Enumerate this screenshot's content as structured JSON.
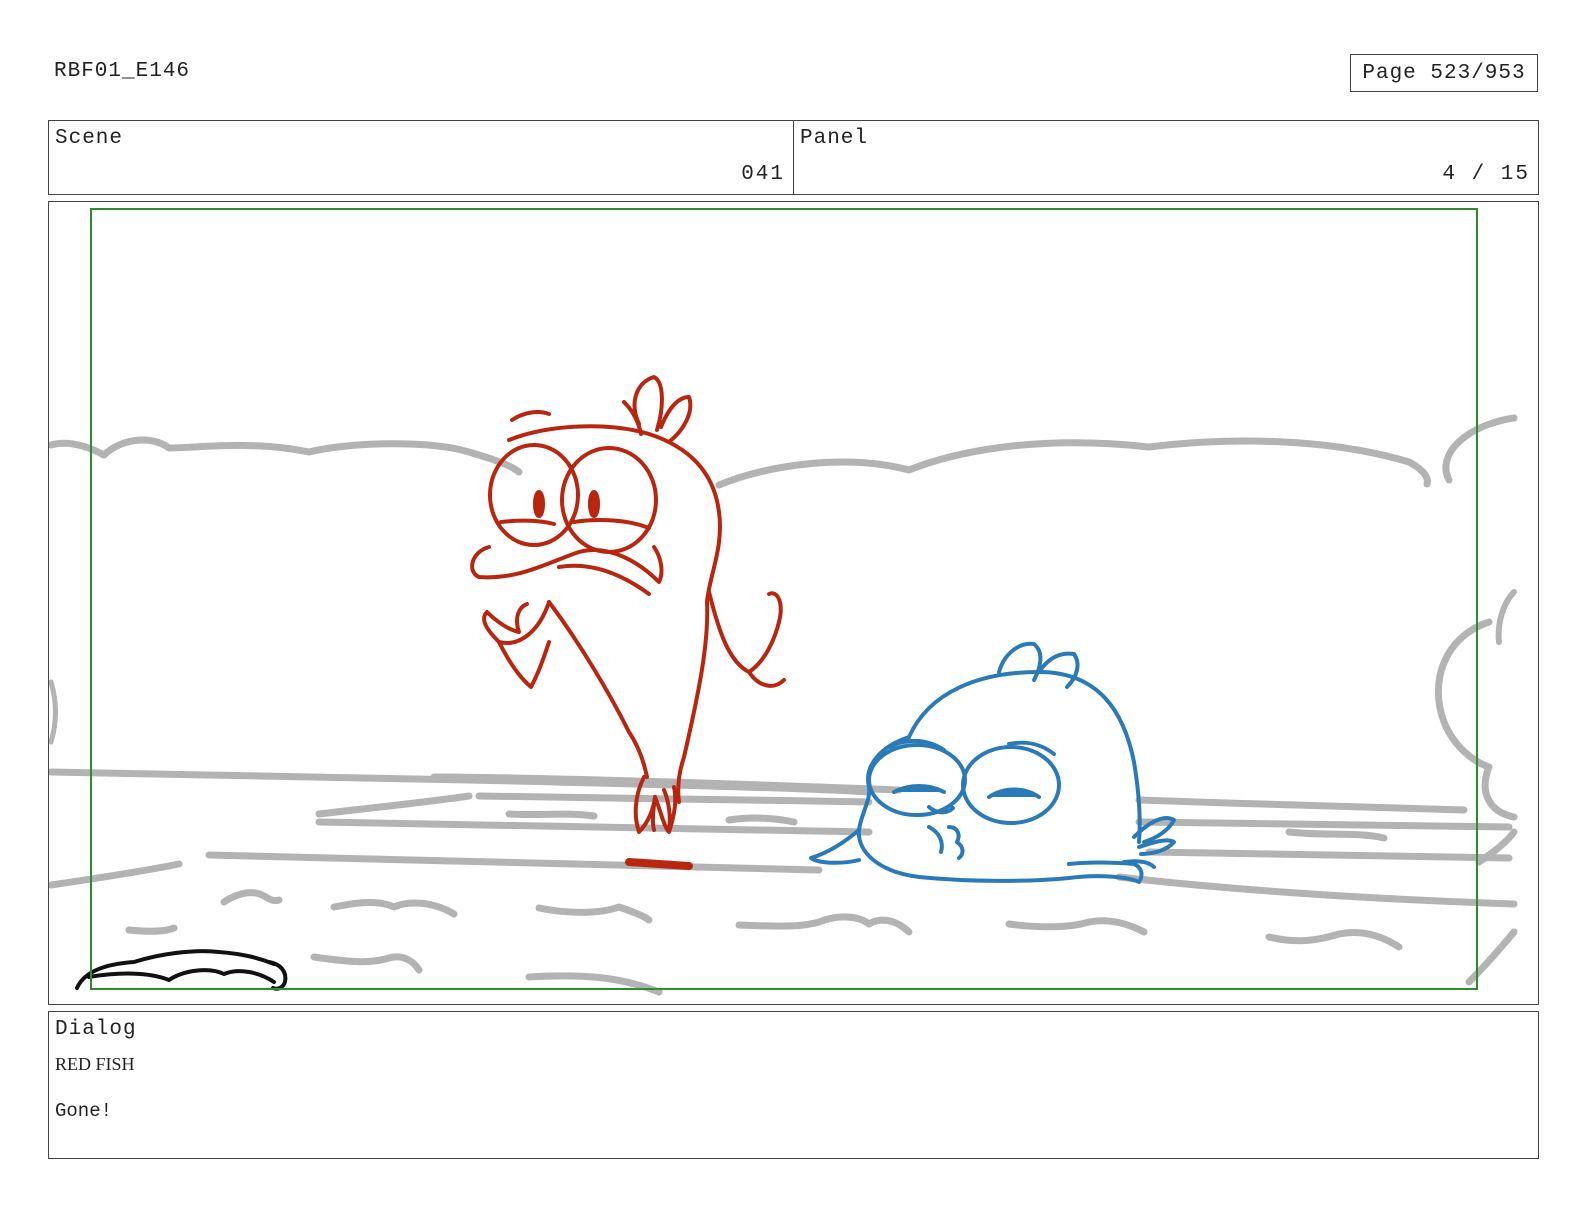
{
  "header": {
    "production_id": "RBF01_E146",
    "page_label": "Page 523/953"
  },
  "info": {
    "scene_label": "Scene",
    "scene_value": "041",
    "panel_label": "Panel",
    "panel_value": "4 / 15"
  },
  "panel": {
    "safe_frame_color": "#2e8b2e",
    "background_line_color": "#b3b3b3",
    "red_fish_color": "#b8260f",
    "blue_fish_color": "#2a7ab8"
  },
  "dialog": {
    "label": "Dialog",
    "speaker": "RED FISH",
    "line": "Gone!"
  }
}
